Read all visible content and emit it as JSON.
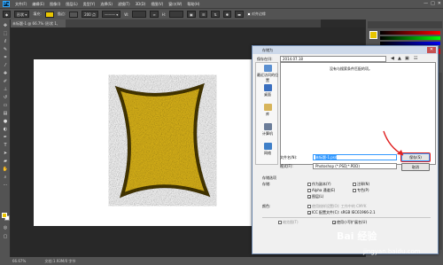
{
  "app": {
    "logo": "Ps"
  },
  "menu": [
    "文件(F)",
    "编辑(E)",
    "图像(I)",
    "图层(L)",
    "类型(Y)",
    "选择(S)",
    "滤镜(T)",
    "3D(D)",
    "视图(V)",
    "窗口(W)",
    "帮助(H)"
  ],
  "window_controls": [
    "—",
    "□",
    "✕"
  ],
  "options_bar": {
    "fill_label": "填充:",
    "stroke_label": "描边:",
    "stroke_size": "200 点",
    "w_label": "W:",
    "h_label": "H:",
    "align_label": "对齐边缘",
    "fill_color": "#e8c500",
    "stroke_color": "#555555"
  },
  "document_tab": {
    "title": "未标题-1 @ 66.7% (形状 1, RGB/8) *"
  },
  "colors": {
    "foreground": "#e8c500",
    "background": "#ffffff",
    "shape_fill": "#e0b81a",
    "shape_stroke": "#4a3a05"
  },
  "status_bar": {
    "zoom": "66.67%",
    "doc": "文档:1.93M/0 字节"
  },
  "dialog": {
    "title": "存储为",
    "close": "✕",
    "save_in_label": "保存在(I):",
    "save_in_value": "2014.07.18",
    "empty_message": "没有与搜索条件匹配的项。",
    "places": [
      "最近访问的位置",
      "桌面",
      "库",
      "计算机",
      "网络"
    ],
    "filename_label": "文件名(N):",
    "filename_value": "未标题-1.psd",
    "format_label": "格式(F):",
    "format_value": "Photoshop (*.PSD;*.PDD)",
    "save_button": "保存(S)",
    "cancel_button": "取消",
    "save_options_label": "存储选项",
    "storage_label": "存储:",
    "as_copy": "作为副本(Y)",
    "notes": "注释(N)",
    "alpha": "Alpha 通道(E)",
    "spot": "专色(P)",
    "layers": "图层(L)",
    "color_label": "颜色:",
    "proof": "使用校样设置(O): 工作中的 CMYK",
    "icc": "ICC 配置文件(C): sRGB IEC61966-2.1",
    "thumbnail": "缩览图(T)",
    "lowercase": "使用小写扩展名(U)"
  },
  "watermark": {
    "brand": "Bai 经验",
    "url": "jingyan.baidu.com"
  }
}
